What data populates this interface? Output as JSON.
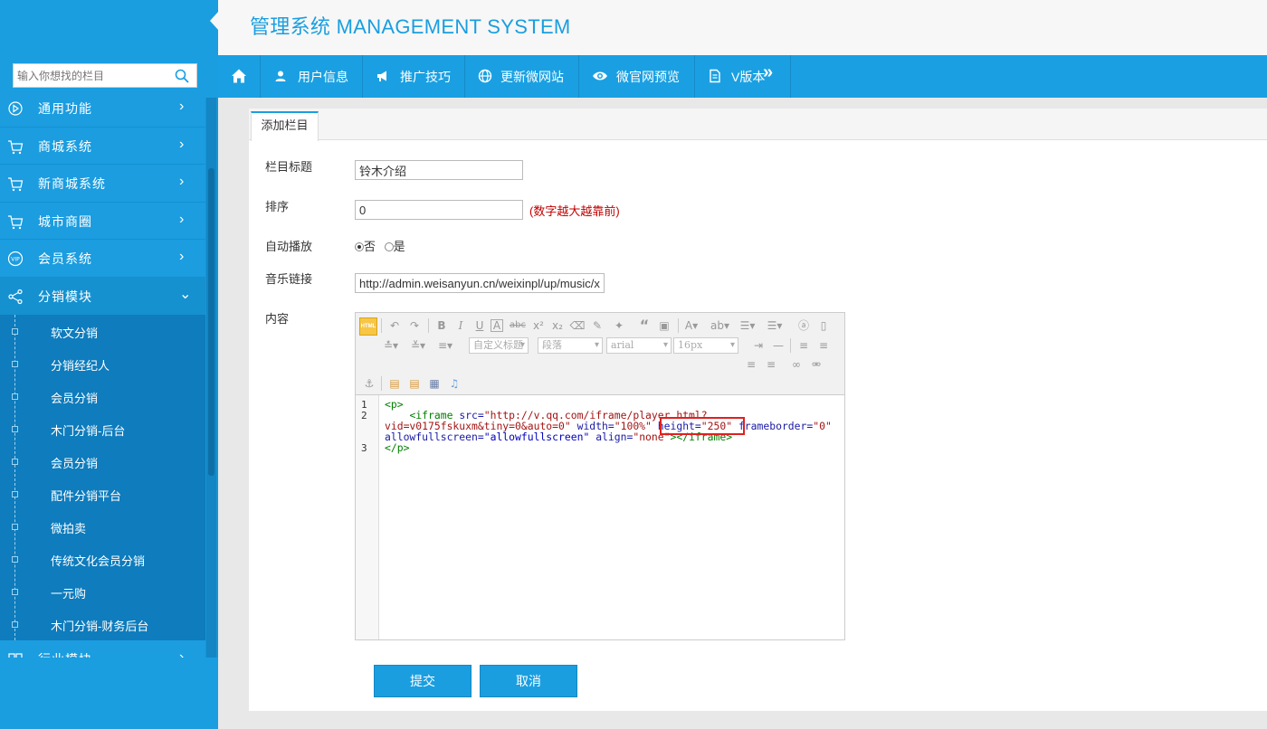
{
  "header": {
    "title": "管理系统 MANAGEMENT SYSTEM"
  },
  "sidebar": {
    "search_placeholder": "输入你想找的栏目",
    "menu": [
      {
        "label": "通用功能",
        "icon": "play-circle-icon"
      },
      {
        "label": "商城系统",
        "icon": "cart-icon"
      },
      {
        "label": "新商城系统",
        "icon": "cart-icon"
      },
      {
        "label": "城市商圈",
        "icon": "cart-icon"
      },
      {
        "label": "会员系统",
        "icon": "vip-icon"
      },
      {
        "label": "分销模块",
        "icon": "share-icon"
      }
    ],
    "submenu": [
      "软文分销",
      "分销经纪人",
      "会员分销",
      "木门分销-后台",
      "会员分销",
      "配件分销平台",
      "微拍卖",
      "传统文化会员分销",
      "一元购",
      "木门分销-财务后台"
    ],
    "partial_item": "行业模块"
  },
  "topnav": [
    {
      "label": "",
      "icon": "home-icon"
    },
    {
      "label": "用户信息",
      "icon": "user-icon"
    },
    {
      "label": "推广技巧",
      "icon": "megaphone-icon"
    },
    {
      "label": "更新微网站",
      "icon": "globe-icon"
    },
    {
      "label": "微官网预览",
      "icon": "eye-icon"
    },
    {
      "label": "V版本",
      "icon": "document-icon"
    }
  ],
  "tab": {
    "label": "添加栏目"
  },
  "form": {
    "title_label": "栏目标题",
    "title_value": "铃木介绍",
    "order_label": "排序",
    "order_value": "0",
    "order_hint": "(数字越大越靠前)",
    "autoplay_label": "自动播放",
    "autoplay_no": "否",
    "autoplay_yes": "是",
    "music_label": "音乐链接",
    "music_value": "http://admin.weisanyun.cn/weixinpl/up/music/xhj",
    "content_label": "内容"
  },
  "editor": {
    "html_button": "HTML",
    "custom_title": "自定义标题",
    "paragraph": "段落",
    "font": "arial",
    "size": "16px",
    "line_numbers": [
      "1",
      "2",
      "3"
    ],
    "code": {
      "p_open": "<p>",
      "iframe_open": "<iframe",
      "src_attr": "src=",
      "src_val_1": "\"http://v.qq.com/iframe/player.html?",
      "src_val_2": "vid=v0175fskuxm&tiny=0&auto=0\"",
      "width_attr": "width=",
      "width_val": "\"100%\"",
      "height_attr": "height=",
      "height_val": "\"250\"",
      "frameborder_attr": "frameborder=",
      "frameborder_val": "\"0\"",
      "allowfs_attr": "allowfullscreen=",
      "allowfs_val": "\"allowfullscreen\"",
      "align_attr": "align=",
      "align_val": "\"none\"",
      "iframe_close": "></iframe>",
      "p_close": "</p>"
    }
  },
  "buttons": {
    "submit": "提交",
    "cancel": "取消"
  },
  "colors": {
    "primary": "#1a9ee0",
    "sidebar_dark": "#0e7cbd",
    "hint_red": "#c00000"
  }
}
